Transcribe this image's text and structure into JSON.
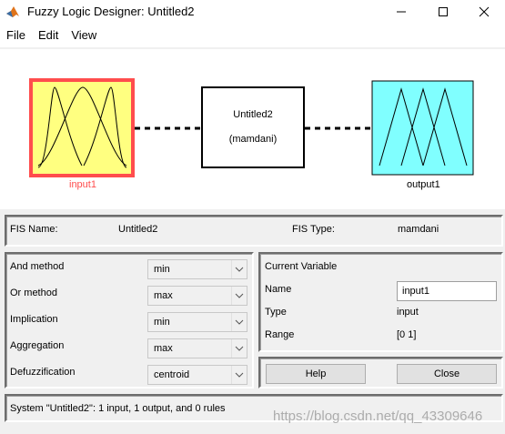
{
  "window": {
    "title": "Fuzzy Logic Designer: Untitled2",
    "minimize_icon": "minimize-icon",
    "maximize_icon": "maximize-icon",
    "close_icon": "close-icon"
  },
  "menu": [
    "File",
    "Edit",
    "View"
  ],
  "diagram": {
    "input_label": "input1",
    "output_label": "output1",
    "system_name": "Untitled2",
    "system_type": "(mamdani)",
    "colors": {
      "input_fill": "#ffff80",
      "input_border": "#ff4d4d",
      "input_label": "#ff4d4d",
      "output_fill": "#80ffff"
    }
  },
  "fis": {
    "name_label": "FIS Name:",
    "name_value": "Untitled2",
    "type_label": "FIS Type:",
    "type_value": "mamdani"
  },
  "methods": [
    {
      "label": "And method",
      "value": "min"
    },
    {
      "label": "Or method",
      "value": "max"
    },
    {
      "label": "Implication",
      "value": "min"
    },
    {
      "label": "Aggregation",
      "value": "max"
    },
    {
      "label": "Defuzzification",
      "value": "centroid"
    }
  ],
  "current_variable": {
    "header": "Current Variable",
    "name_label": "Name",
    "name_value": "input1",
    "type_label": "Type",
    "type_value": "input",
    "range_label": "Range",
    "range_value": "[0 1]"
  },
  "buttons": {
    "help": "Help",
    "close": "Close"
  },
  "status": "System \"Untitled2\": 1 input, 1 output, and 0 rules",
  "watermark": "https://blog.csdn.net/qq_43309646"
}
